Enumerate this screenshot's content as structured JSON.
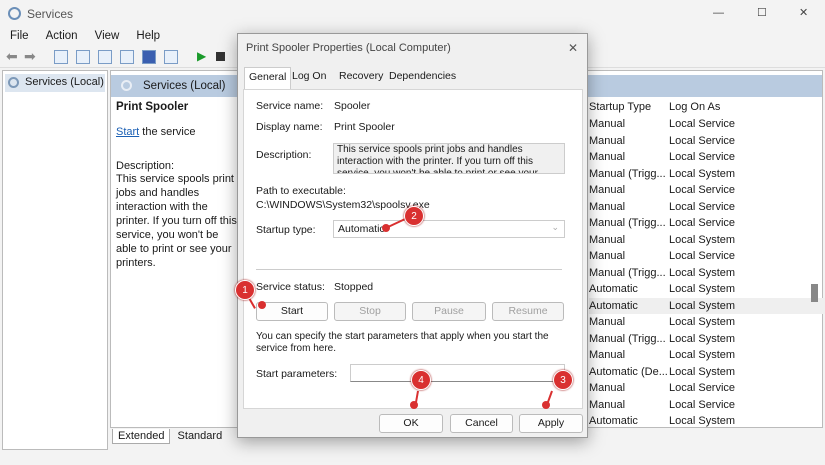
{
  "window": {
    "title": "Services",
    "menu": [
      "File",
      "Action",
      "View",
      "Help"
    ],
    "controls": [
      "—",
      "☐",
      "✕"
    ]
  },
  "tree": {
    "item": "Services (Local)"
  },
  "right": {
    "header": "Services (Local)",
    "service_title": "Print Spooler",
    "start_link": "Start",
    "start_rest": " the service",
    "desc_label": "Description:",
    "desc_text": "This service spools print jobs and handles interaction with the printer. If you turn off this service, you won't be able to print or see your printers.",
    "columns": [
      "Startup Type",
      "Log On As"
    ],
    "rows": [
      [
        "Manual",
        "Local Service"
      ],
      [
        "Manual",
        "Local Service"
      ],
      [
        "Manual",
        "Local Service"
      ],
      [
        "Manual (Trigg...",
        "Local System"
      ],
      [
        "Manual",
        "Local Service"
      ],
      [
        "Manual",
        "Local Service"
      ],
      [
        "Manual (Trigg...",
        "Local Service"
      ],
      [
        "Manual",
        "Local System"
      ],
      [
        "Manual",
        "Local Service"
      ],
      [
        "Manual (Trigg...",
        "Local System"
      ],
      [
        "Automatic",
        "Local System"
      ],
      [
        "Automatic",
        "Local System"
      ],
      [
        "Manual",
        "Local System"
      ],
      [
        "Manual (Trigg...",
        "Local System"
      ],
      [
        "Manual",
        "Local System"
      ],
      [
        "Automatic (De...",
        "Local System"
      ],
      [
        "Manual",
        "Local Service"
      ],
      [
        "Manual",
        "Local Service"
      ],
      [
        "Automatic",
        "Local System"
      ]
    ],
    "bottom_tabs": [
      "Extended",
      "Standard"
    ]
  },
  "dialog": {
    "title": "Print Spooler Properties (Local Computer)",
    "close": "✕",
    "tabs": [
      "General",
      "Log On",
      "Recovery",
      "Dependencies"
    ],
    "service_name_label": "Service name:",
    "service_name": "Spooler",
    "display_name_label": "Display name:",
    "display_name": "Print Spooler",
    "description_label": "Description:",
    "description": "This service spools print jobs and handles interaction with the printer.  If you turn off this service, you won't be able to print or see your printers.",
    "path_label": "Path to executable:",
    "path": "C:\\WINDOWS\\System32\\spoolsv.exe",
    "startup_label": "Startup type:",
    "startup_value": "Automatic",
    "status_label": "Service status:",
    "status_value": "Stopped",
    "buttons": {
      "start": "Start",
      "stop": "Stop",
      "pause": "Pause",
      "resume": "Resume"
    },
    "params_note": "You can specify the start parameters that apply when you start the service from here.",
    "params_label": "Start parameters:",
    "params_value": "",
    "ok": "OK",
    "cancel": "Cancel",
    "apply": "Apply"
  },
  "annotations": [
    "1",
    "2",
    "3",
    "4"
  ]
}
